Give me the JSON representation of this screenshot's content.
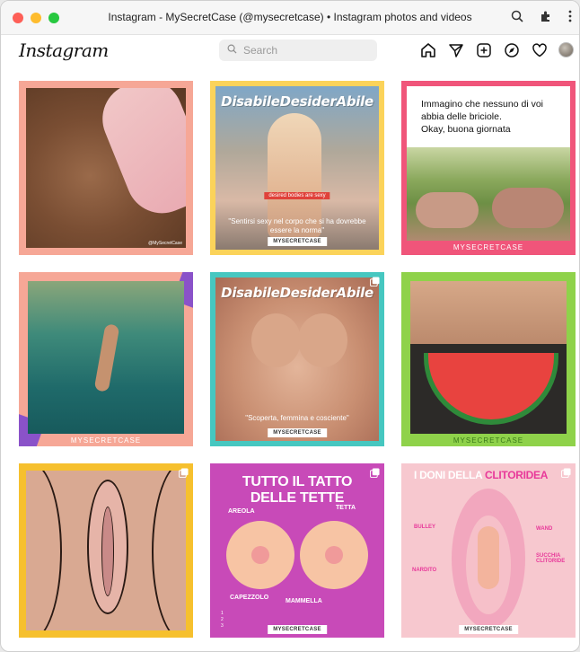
{
  "window": {
    "title": "Instagram - MySecretCase (@mysecretcase) • Instagram photos and videos",
    "colors": {
      "close": "#fe5f57",
      "minimize": "#febc2e",
      "zoom": "#28c840"
    }
  },
  "browser_icons": [
    "zoom-icon",
    "extensions-icon",
    "more-vert-icon"
  ],
  "header": {
    "logo": "Instagram",
    "search_placeholder": "Search",
    "nav_icons": [
      "home-icon",
      "direct-message-icon",
      "new-post-icon",
      "explore-icon",
      "activity-heart-icon",
      "profile-avatar"
    ]
  },
  "posts": [
    {
      "id": 1,
      "frame_color": "#f6a796",
      "tiny_credit": "@MySecretCase"
    },
    {
      "id": 2,
      "frame_color": "#fbd35a",
      "headline": "DisabileDesiderAbile",
      "pill": "desired bodies are sexy",
      "caption": "\"Sentirsi sexy nel corpo che si ha dovrebbe essere la norma\"",
      "brand": "MYSECRETCASE"
    },
    {
      "id": 3,
      "frame_color": "#f0557a",
      "text_line1": "Immagino che nessuno di voi",
      "text_line2": "abbia delle briciole.",
      "text_line3": "Okay, buona giornata",
      "brand": "MYSECRETCASE"
    },
    {
      "id": 4,
      "frame_color": "#f6a796",
      "brand": "MYSECRETCASE"
    },
    {
      "id": 5,
      "frame_color": "#46c7c0",
      "headline": "DisabileDesiderAbile",
      "caption": "\"Scoperta, femmina e cosciente\"",
      "brand": "MYSECRETCASE"
    },
    {
      "id": 6,
      "frame_color": "#8fd24a",
      "brand": "MYSECRETCASE"
    },
    {
      "id": 7,
      "frame_color": "#f6c02e"
    },
    {
      "id": 8,
      "frame_color": "#c84ab8",
      "headline_line1": "TUTTO IL TATTO",
      "headline_line2": "DELLE TETTE",
      "labels": [
        "AREOLA",
        "TETTA",
        "CAPEZZOLO",
        "MAMMELLA",
        "1",
        "2",
        "3"
      ],
      "brand": "MYSECRETCASE"
    },
    {
      "id": 9,
      "frame_color": "#f7c8cf",
      "headline_left": "I DONI DELLA ",
      "headline_right": "CLITORIDEA",
      "labels": [
        "BULLEY",
        "WAND",
        "SUCCHIA CLITORIDE",
        "NARDITO"
      ],
      "brand": "MYSECRETCASE"
    }
  ]
}
